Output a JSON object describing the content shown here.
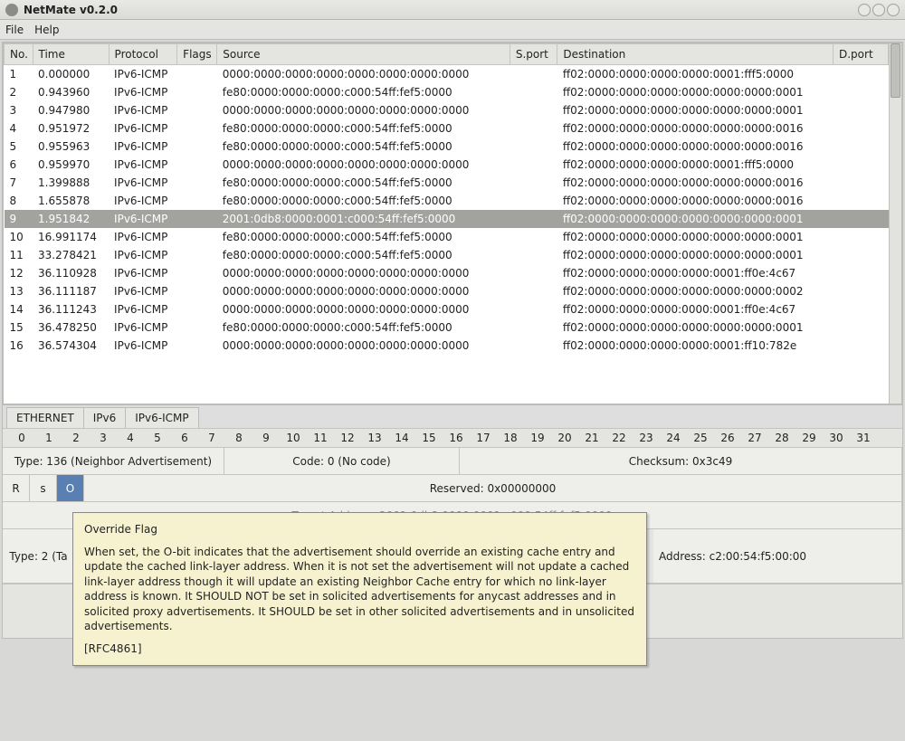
{
  "title": "NetMate v0.2.0",
  "menu": {
    "file": "File",
    "help": "Help"
  },
  "columns": [
    "No.",
    "Time",
    "Protocol",
    "Flags",
    "Source",
    "S.port",
    "Destination",
    "D.port"
  ],
  "rows": [
    {
      "no": "1",
      "time": "0.000000",
      "proto": "IPv6-ICMP",
      "flags": "",
      "src": "0000:0000:0000:0000:0000:0000:0000:0000",
      "sport": "",
      "dst": "ff02:0000:0000:0000:0000:0001:fff5:0000",
      "dport": ""
    },
    {
      "no": "2",
      "time": "0.943960",
      "proto": "IPv6-ICMP",
      "flags": "",
      "src": "fe80:0000:0000:0000:c000:54ff:fef5:0000",
      "sport": "",
      "dst": "ff02:0000:0000:0000:0000:0000:0000:0001",
      "dport": ""
    },
    {
      "no": "3",
      "time": "0.947980",
      "proto": "IPv6-ICMP",
      "flags": "",
      "src": "0000:0000:0000:0000:0000:0000:0000:0000",
      "sport": "",
      "dst": "ff02:0000:0000:0000:0000:0000:0000:0001",
      "dport": ""
    },
    {
      "no": "4",
      "time": "0.951972",
      "proto": "IPv6-ICMP",
      "flags": "",
      "src": "fe80:0000:0000:0000:c000:54ff:fef5:0000",
      "sport": "",
      "dst": "ff02:0000:0000:0000:0000:0000:0000:0016",
      "dport": ""
    },
    {
      "no": "5",
      "time": "0.955963",
      "proto": "IPv6-ICMP",
      "flags": "",
      "src": "fe80:0000:0000:0000:c000:54ff:fef5:0000",
      "sport": "",
      "dst": "ff02:0000:0000:0000:0000:0000:0000:0016",
      "dport": ""
    },
    {
      "no": "6",
      "time": "0.959970",
      "proto": "IPv6-ICMP",
      "flags": "",
      "src": "0000:0000:0000:0000:0000:0000:0000:0000",
      "sport": "",
      "dst": "ff02:0000:0000:0000:0000:0001:fff5:0000",
      "dport": ""
    },
    {
      "no": "7",
      "time": "1.399888",
      "proto": "IPv6-ICMP",
      "flags": "",
      "src": "fe80:0000:0000:0000:c000:54ff:fef5:0000",
      "sport": "",
      "dst": "ff02:0000:0000:0000:0000:0000:0000:0016",
      "dport": ""
    },
    {
      "no": "8",
      "time": "1.655878",
      "proto": "IPv6-ICMP",
      "flags": "",
      "src": "fe80:0000:0000:0000:c000:54ff:fef5:0000",
      "sport": "",
      "dst": "ff02:0000:0000:0000:0000:0000:0000:0016",
      "dport": ""
    },
    {
      "no": "9",
      "time": "1.951842",
      "proto": "IPv6-ICMP",
      "flags": "",
      "src": "2001:0db8:0000:0001:c000:54ff:fef5:0000",
      "sport": "",
      "dst": "ff02:0000:0000:0000:0000:0000:0000:0001",
      "dport": ""
    },
    {
      "no": "10",
      "time": "16.991174",
      "proto": "IPv6-ICMP",
      "flags": "",
      "src": "fe80:0000:0000:0000:c000:54ff:fef5:0000",
      "sport": "",
      "dst": "ff02:0000:0000:0000:0000:0000:0000:0001",
      "dport": ""
    },
    {
      "no": "11",
      "time": "33.278421",
      "proto": "IPv6-ICMP",
      "flags": "",
      "src": "fe80:0000:0000:0000:c000:54ff:fef5:0000",
      "sport": "",
      "dst": "ff02:0000:0000:0000:0000:0000:0000:0001",
      "dport": ""
    },
    {
      "no": "12",
      "time": "36.110928",
      "proto": "IPv6-ICMP",
      "flags": "",
      "src": "0000:0000:0000:0000:0000:0000:0000:0000",
      "sport": "",
      "dst": "ff02:0000:0000:0000:0000:0001:ff0e:4c67",
      "dport": ""
    },
    {
      "no": "13",
      "time": "36.111187",
      "proto": "IPv6-ICMP",
      "flags": "",
      "src": "0000:0000:0000:0000:0000:0000:0000:0000",
      "sport": "",
      "dst": "ff02:0000:0000:0000:0000:0000:0000:0002",
      "dport": ""
    },
    {
      "no": "14",
      "time": "36.111243",
      "proto": "IPv6-ICMP",
      "flags": "",
      "src": "0000:0000:0000:0000:0000:0000:0000:0000",
      "sport": "",
      "dst": "ff02:0000:0000:0000:0000:0001:ff0e:4c67",
      "dport": ""
    },
    {
      "no": "15",
      "time": "36.478250",
      "proto": "IPv6-ICMP",
      "flags": "",
      "src": "fe80:0000:0000:0000:c000:54ff:fef5:0000",
      "sport": "",
      "dst": "ff02:0000:0000:0000:0000:0000:0000:0001",
      "dport": ""
    },
    {
      "no": "16",
      "time": "36.574304",
      "proto": "IPv6-ICMP",
      "flags": "",
      "src": "0000:0000:0000:0000:0000:0000:0000:0000",
      "sport": "",
      "dst": "ff02:0000:0000:0000:0000:0001:ff10:782e",
      "dport": ""
    }
  ],
  "selected_row": 8,
  "proto_tabs": [
    "ETHERNET",
    "IPv6",
    "IPv6-ICMP"
  ],
  "byte_indices": [
    "0",
    "1",
    "2",
    "3",
    "4",
    "5",
    "6",
    "7",
    "8",
    "9",
    "10",
    "11",
    "12",
    "13",
    "14",
    "15",
    "16",
    "17",
    "18",
    "19",
    "20",
    "21",
    "22",
    "23",
    "24",
    "25",
    "26",
    "27",
    "28",
    "29",
    "30",
    "31"
  ],
  "decode": {
    "type": "Type: 136 (Neighbor Advertisement)",
    "code": "Code: 0 (No code)",
    "checksum": "Checksum: 0x3c49",
    "flag_r": "R",
    "flag_s": "s",
    "flag_o": "O",
    "reserved": "Reserved: 0x00000000",
    "target": "Target Address: 2001:0db8:0000:0001:c000:54ff:fef5:0000",
    "tlv_type": "Type: 2 (Ta",
    "tlv_addr": "Address: c2:00:54:f5:00:00"
  },
  "tooltip": {
    "title": "Override Flag",
    "body": "When set, the O-bit indicates that the advertisement should override an existing cache entry and update the cached link-layer address. When it is not set the advertisement will not update a cached link-layer address though it will update an existing Neighbor Cache entry for which no link-layer address is known.  It SHOULD NOT be set in solicited advertisements for anycast addresses and in solicited proxy advertisements. It SHOULD be set in other solicited advertisements and in unsolicited advertisements.",
    "ref": "[RFC4861]"
  }
}
